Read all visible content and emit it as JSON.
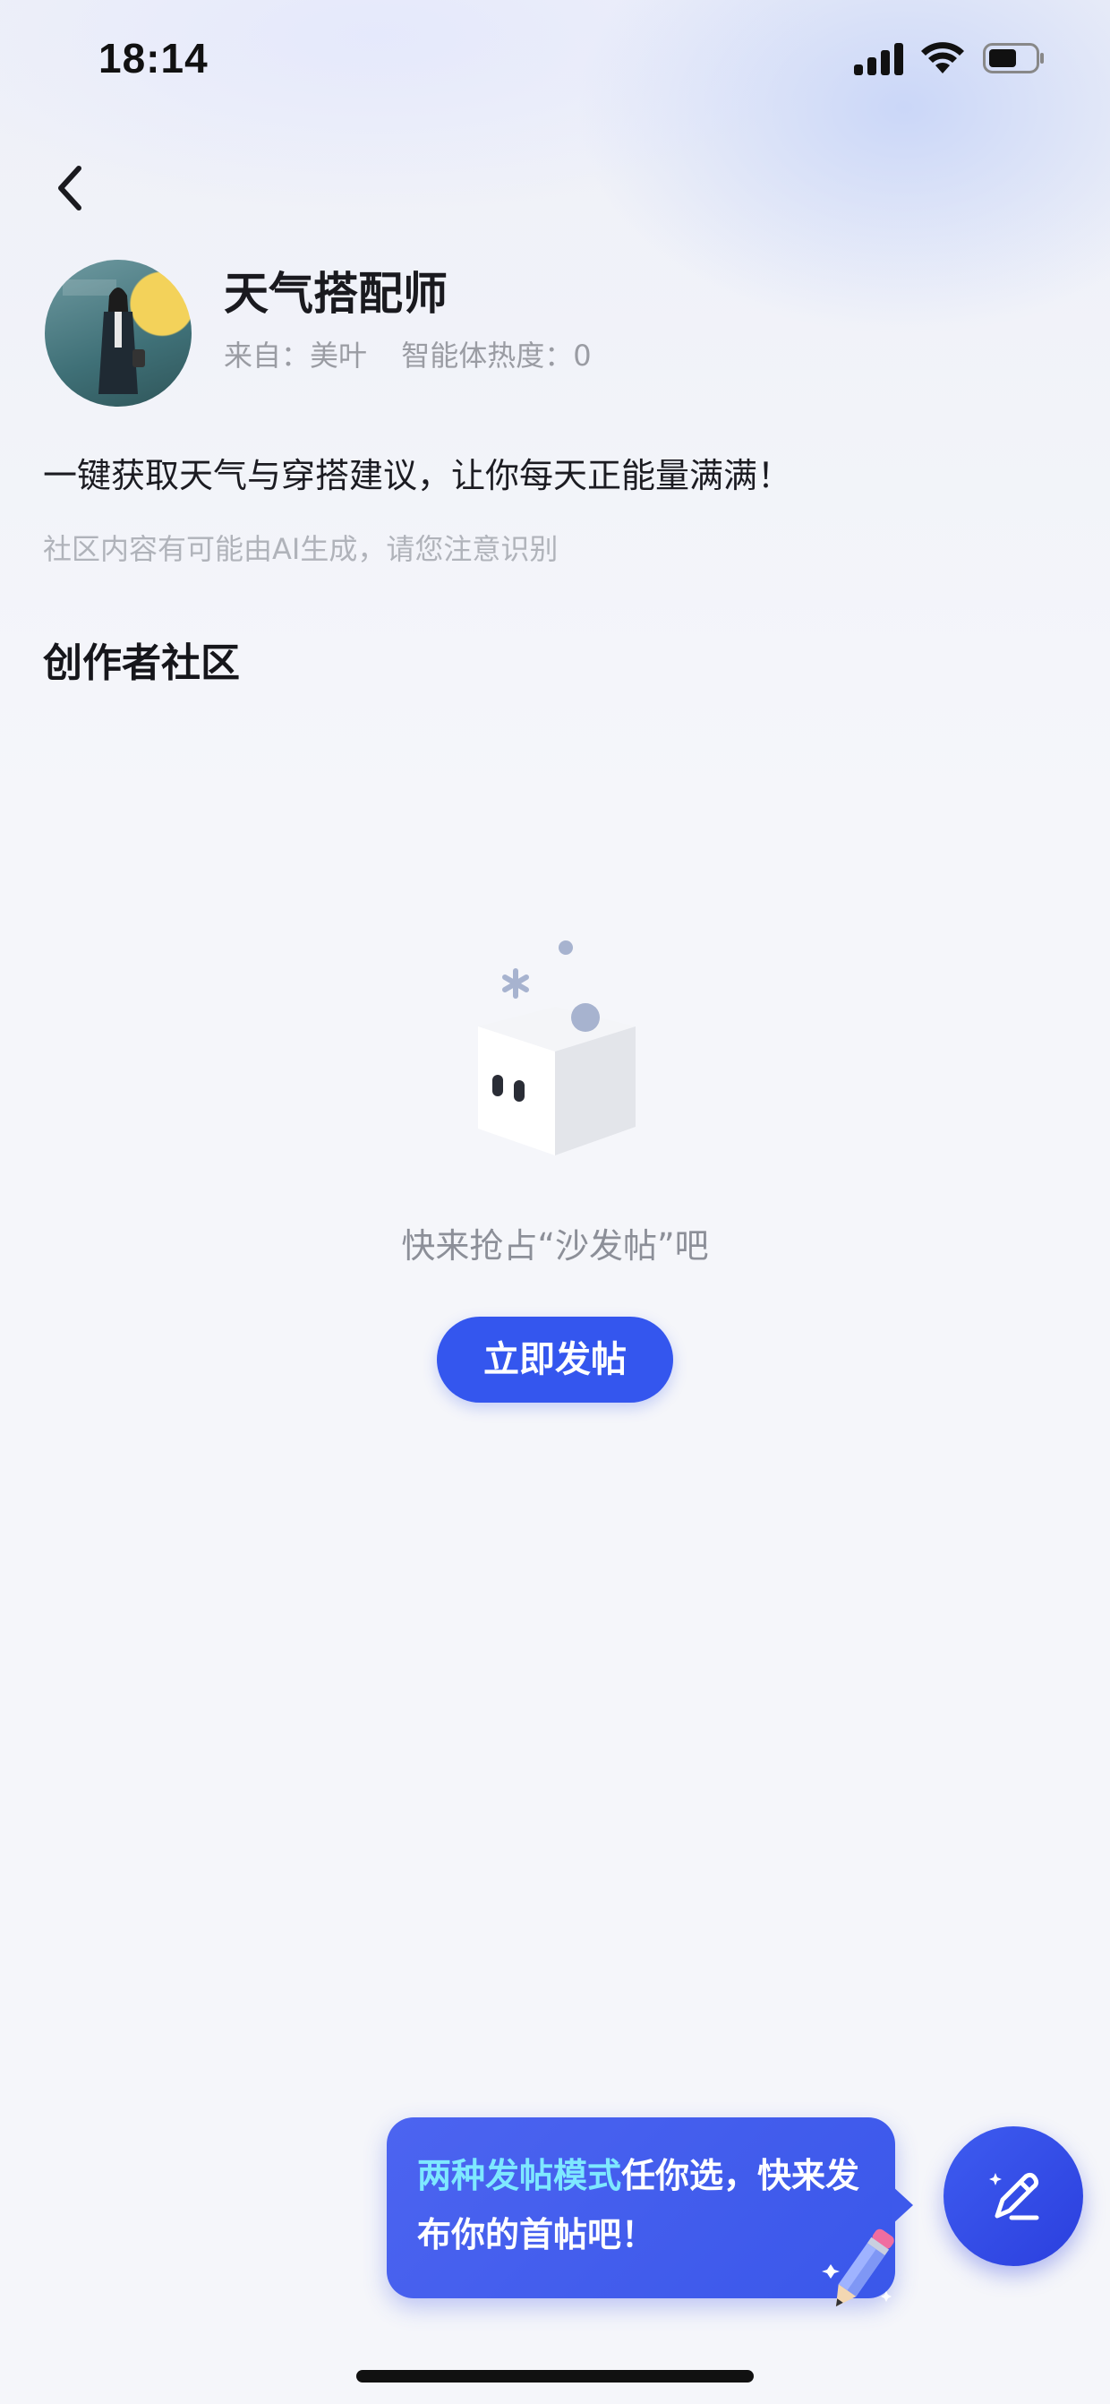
{
  "status_bar": {
    "time": "18:14"
  },
  "agent": {
    "name": "天气搭配师",
    "from": "来自：美叶",
    "heat": "智能体热度：0",
    "description": "一键获取天气与穿搭建议，让你每天正能量满满！",
    "ai_notice": "社区内容有可能由AI生成，请您注意识别"
  },
  "community": {
    "title": "创作者社区",
    "empty_text": "快来抢占“沙发帖”吧",
    "post_button": "立即发帖"
  },
  "tooltip": {
    "highlight": "两种发帖模式",
    "rest": "任你选，快来发布你的首帖吧！"
  },
  "colors": {
    "accent": "#3456ee",
    "tooltip_highlight": "#7ee8ff"
  },
  "icons": [
    "back-arrow-icon",
    "signal-icon",
    "wifi-icon",
    "battery-icon",
    "empty-box-icon",
    "pencil-icon",
    "compose-icon"
  ]
}
